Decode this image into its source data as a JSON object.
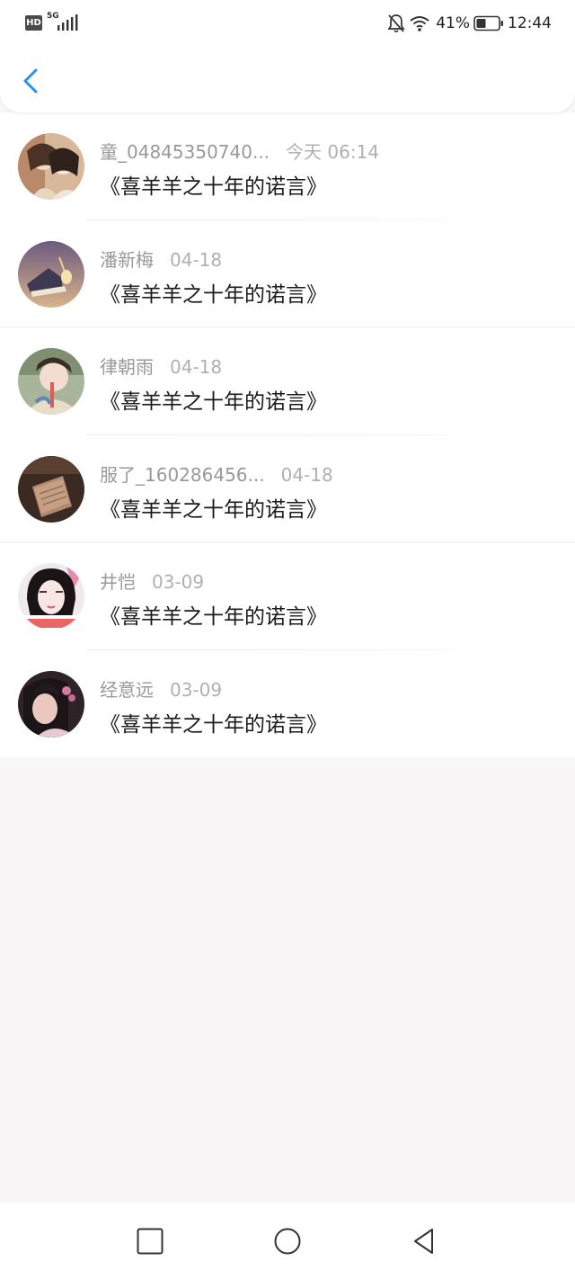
{
  "status_bar": {
    "hd": "HD",
    "network": "5G",
    "battery_percent": "41%",
    "time": "12:44",
    "icons": [
      "hd-badge-icon",
      "signal-icon",
      "bell-mute-icon",
      "wifi-icon",
      "battery-icon"
    ]
  },
  "header": {
    "back_icon": "chevron-left-icon",
    "accent_color": "#2196f3"
  },
  "list": [
    {
      "name": "童_04845350740...",
      "time": "今天 06:14",
      "title": "《喜羊羊之十年的诺言》"
    },
    {
      "name": "潘新梅",
      "time": "04-18",
      "title": "《喜羊羊之十年的诺言》"
    },
    {
      "name": "律朝雨",
      "time": "04-18",
      "title": "《喜羊羊之十年的诺言》"
    },
    {
      "name": "服了_160286456...",
      "time": "04-18",
      "title": "《喜羊羊之十年的诺言》"
    },
    {
      "name": "井恺",
      "time": "03-09",
      "title": "《喜羊羊之十年的诺言》"
    },
    {
      "name": "经意远",
      "time": "03-09",
      "title": "《喜羊羊之十年的诺言》"
    }
  ],
  "nav_bar": {
    "icons": [
      "square-recents-icon",
      "circle-home-icon",
      "triangle-back-icon"
    ]
  }
}
